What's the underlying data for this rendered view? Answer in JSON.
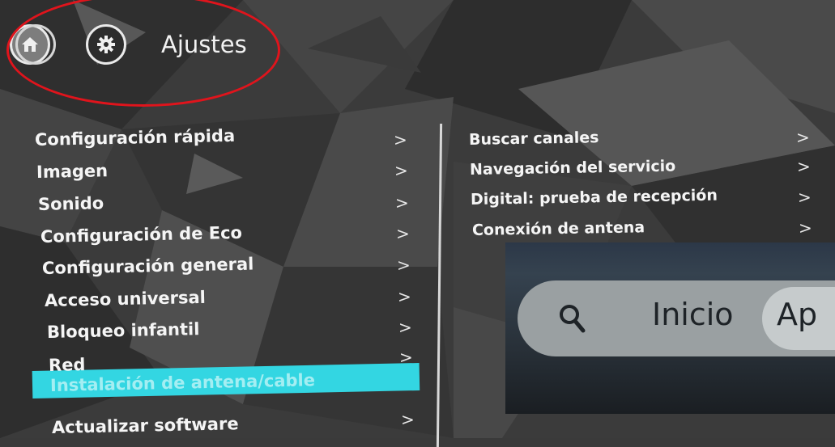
{
  "header": {
    "title": "Ajustes",
    "home_icon": "home-icon",
    "settings_icon": "gear-icon"
  },
  "main_menu": {
    "chevron": ">",
    "items": [
      {
        "label": "Configuración rápida"
      },
      {
        "label": "Imagen"
      },
      {
        "label": "Sonido"
      },
      {
        "label": "Configuración de Eco"
      },
      {
        "label": "Configuración general"
      },
      {
        "label": "Acceso universal"
      },
      {
        "label": "Bloqueo infantil"
      },
      {
        "label": "Red"
      },
      {
        "label": "Instalación de antena/cable",
        "selected": true
      },
      {
        "label": "Actualizar software"
      }
    ]
  },
  "sub_menu": {
    "items": [
      {
        "label": "Buscar canales"
      },
      {
        "label": "Navegación del servicio"
      },
      {
        "label": "Digital: prueba de recepción"
      },
      {
        "label": "Conexión de antena"
      }
    ]
  },
  "inset": {
    "home_label": "Inicio",
    "next_chip_label": "Ap",
    "search_icon": "search-icon"
  },
  "colors": {
    "selection": "#33d6e2",
    "annotation": "#e0141c"
  }
}
